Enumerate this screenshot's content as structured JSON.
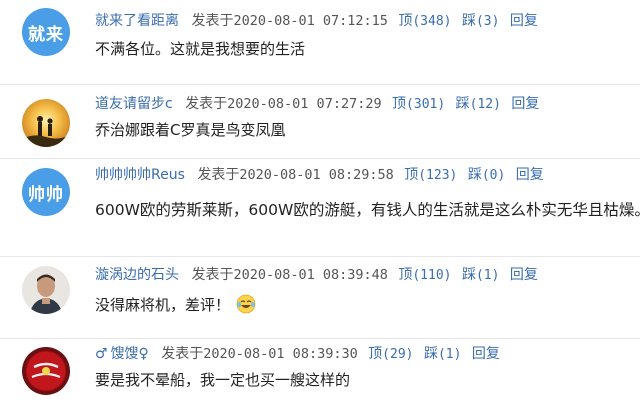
{
  "labels": {
    "posted": "发表于",
    "up": "顶",
    "down": "踩",
    "reply": "回复"
  },
  "comments": [
    {
      "avatar_text": "就来",
      "avatar_color": "#4a9ee8",
      "username": "就来了看距离",
      "time": "2020-08-01 07:12:15",
      "up_count": "(348)",
      "down_count": "(3)",
      "text": "不满各位。这就是我想要的生活"
    },
    {
      "avatar_icon": "sunset-silhouette-avatar",
      "username": "道友请留步c",
      "time": "2020-08-01 07:27:29",
      "up_count": "(301)",
      "down_count": "(12)",
      "text": "乔治娜跟着C罗真是鸟变凤凰"
    },
    {
      "avatar_text": "帅帅",
      "avatar_color": "#4a9ee8",
      "username": "帅帅帅帅Reus",
      "time": "2020-08-01 08:29:58",
      "up_count": "(123)",
      "down_count": "(0)",
      "text": "600W欧的劳斯莱斯，600W欧的游艇，有钱人的生活就是这么朴实无华且枯燥。。"
    },
    {
      "avatar_icon": "person-photo-avatar",
      "username": "漩涡边的石头",
      "time": "2020-08-01 08:39:48",
      "up_count": "(110)",
      "down_count": "(1)",
      "text": "没得麻将机，差评！",
      "emoji": "laughing-tears-emoji"
    },
    {
      "avatar_icon": "red-ball-avatar",
      "gender_icon": "♂",
      "username": "馊馊♀",
      "time": "2020-08-01 08:39:30",
      "up_count": "(29)",
      "down_count": "(1)",
      "text": "要是我不晕船，我一定也买一艘这样的"
    }
  ]
}
